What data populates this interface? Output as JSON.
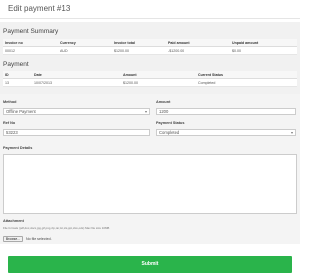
{
  "header": {
    "title": "Edit payment #13"
  },
  "summary": {
    "title": "Payment Summary",
    "columns": [
      "Invoice no",
      "Currency",
      "Invoice total",
      "Paid amount",
      "Unpaid amount"
    ],
    "rows": [
      [
        "00012",
        "AUD",
        "$1200.00",
        "-$1200.00",
        "$0.00"
      ]
    ]
  },
  "payment": {
    "title": "Payment",
    "columns": [
      "ID",
      "Date",
      "Amount",
      "Current Status"
    ],
    "rows": [
      [
        "13",
        "10/07/2013",
        "$1200.00",
        "Completed"
      ]
    ]
  },
  "form": {
    "method_label": "Method",
    "method_value": "Offline Payment",
    "amount_label": "Amount",
    "amount_value": "1200",
    "ref_label": "Ref No",
    "ref_value": "53223",
    "status_label": "Payment Status",
    "status_value": "Completed",
    "details_label": "Payment Details",
    "attachment_label": "Attachment",
    "attachment_hint": "File formats (pdf,doc,docx,jpg,gif,png,zip,rar,txt,xls,ppt,xlsx,ods) Max file size 10MB",
    "browse_label": "Browse...",
    "file_status": "No file selected.",
    "submit_label": "Submit"
  },
  "colors": {
    "submit_green": "#2ab44b",
    "section_bg": "#f1f1f1"
  },
  "icons": {
    "select_caret": "caret-down-icon"
  }
}
